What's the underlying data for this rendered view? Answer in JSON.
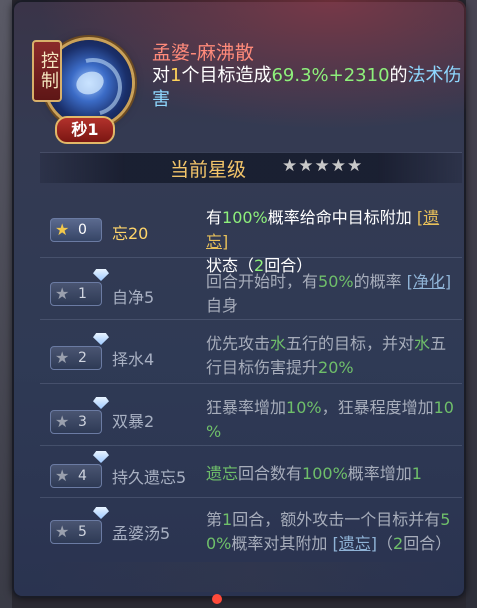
{
  "skill": {
    "control_label": "控制",
    "seconds_label": "秒1",
    "title": "孟婆-麻沸散",
    "desc_parts": {
      "p1": "对",
      "n_targets": "1",
      "p2": "个目标造成",
      "pct": "69.3%+2310",
      "p3": "的",
      "damage_type": "法术伤害"
    }
  },
  "star_header": {
    "label": "当前星级",
    "stars": "★★★★★"
  },
  "rows": [
    {
      "star_num": "0",
      "name": "忘20",
      "line1_a": "有",
      "line1_pct": "100%",
      "line1_b": "概率给命中目标附加 ",
      "line1_link": "[遗忘]",
      "line2_a": "状态（",
      "line2_num": "2",
      "line2_b": "回合）"
    },
    {
      "star_num": "1",
      "name": "自净5",
      "line1_a": "回合开始时，有",
      "line1_pct": "50%",
      "line1_b": "的概率 ",
      "line1_link": "[净化]",
      "line2_a": "自身"
    },
    {
      "star_num": "2",
      "name": "择水4",
      "line1_a": "优先攻击",
      "line1_w1": "水",
      "line1_b": "五行的目标，并对",
      "line1_w2": "水",
      "line1_c": "五",
      "line2_a": "行目标伤害提升",
      "line2_pct": "20%"
    },
    {
      "star_num": "3",
      "name": "双暴2",
      "line1_a": "狂暴率增加",
      "line1_pct": "10%",
      "line1_b": "，狂暴程度增加",
      "line1_pct2a": "10",
      "line2_pct2b": "%"
    },
    {
      "star_num": "4",
      "name": "持久遗忘5",
      "line1_link": "遗忘",
      "line1_a": "回合数有",
      "line1_pct": "100%",
      "line1_b": "概率增加",
      "line1_num": "1"
    },
    {
      "star_num": "5",
      "name": "孟婆汤5",
      "line1_a": "第",
      "line1_num": "1",
      "line1_b": "回合，额外攻击一个目标并有",
      "line1_pct_a": "5",
      "line2_pct_b": "0%",
      "line2_a": "概率对其附加 ",
      "line2_link": "[遗忘]",
      "line2_b": "（",
      "line2_num": "2",
      "line2_c": "回合）"
    }
  ],
  "colors": {
    "title": "#ff8a7a",
    "highlight_green": "#8ef07b",
    "damage_blue": "#8fd8ff",
    "star_gold": "#f2c84b",
    "header_gold": "#f3c56a"
  }
}
